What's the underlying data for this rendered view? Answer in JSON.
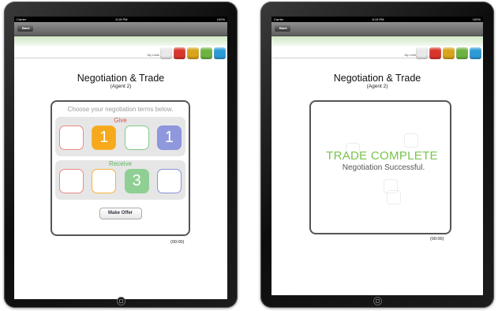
{
  "status_bar": {
    "carrier": "Carrier",
    "time": "8:15 PM",
    "battery": "100%"
  },
  "nav": {
    "back_label": "Back"
  },
  "units": {
    "label": "My Units",
    "colors": [
      "#e9e9e9",
      "#d9342b",
      "#d9a419",
      "#6db33f",
      "#2b9bd6"
    ]
  },
  "screen_offer": {
    "title": "Negotiation & Trade",
    "subtitle": "(Agent 2)",
    "prompt": "Choose your negotiation terms below.",
    "give": {
      "label": "Give",
      "label_color": "#d9534f",
      "slots": [
        {
          "value": "",
          "border": "#e98b86",
          "fill": ""
        },
        {
          "value": "1",
          "border": "#f5b33b",
          "fill": "#f5a91b"
        },
        {
          "value": "",
          "border": "#86c98a",
          "fill": ""
        },
        {
          "value": "1",
          "border": "#8a93d6",
          "fill": "#8f98dc"
        }
      ]
    },
    "receive": {
      "label": "Receive",
      "label_color": "#5cb85c",
      "slots": [
        {
          "value": "",
          "border": "#e98b86",
          "fill": ""
        },
        {
          "value": "",
          "border": "#f5b33b",
          "fill": ""
        },
        {
          "value": "3",
          "border": "#8fcf93",
          "fill": "#8fcf93"
        },
        {
          "value": "",
          "border": "#8a93d6",
          "fill": ""
        }
      ]
    },
    "offer_button": "Make Offer",
    "timer": "(00:00)"
  },
  "screen_complete": {
    "title": "Negotiation & Trade",
    "subtitle": "(Agent 2)",
    "headline": "TRADE COMPLETE",
    "message": "Negotiation Successful.",
    "timer": "(00:00)"
  }
}
